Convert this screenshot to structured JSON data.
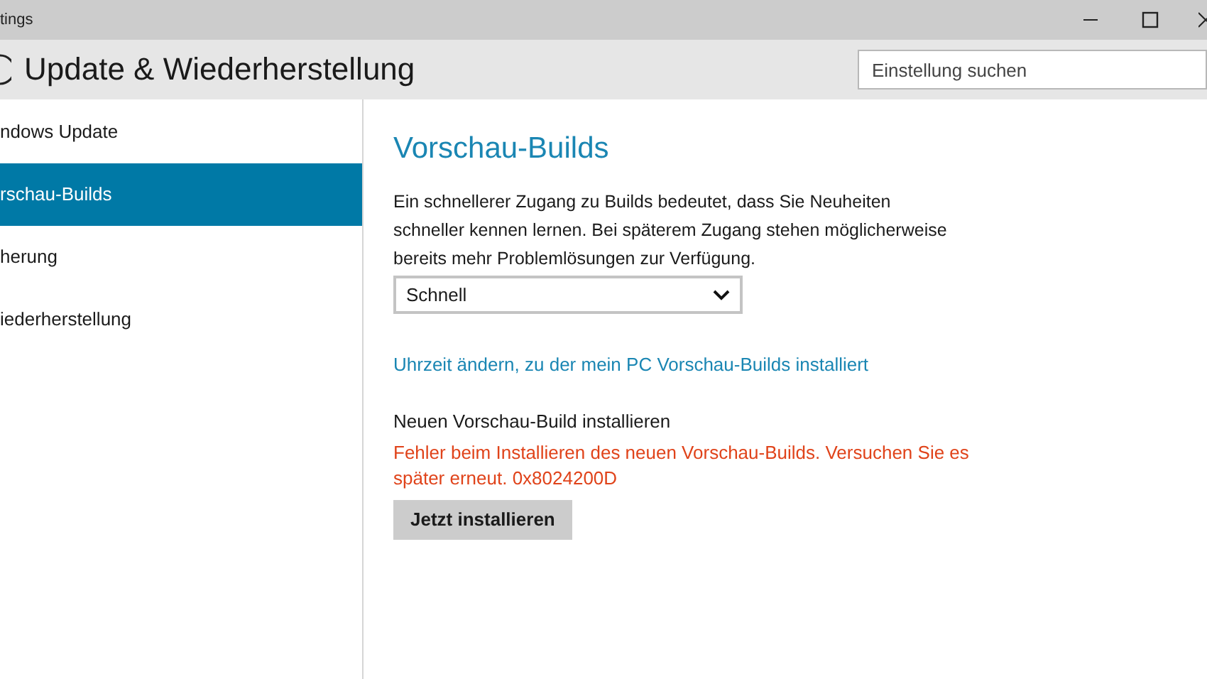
{
  "window": {
    "title": "tings"
  },
  "header": {
    "title": "Update & Wiederherstellung",
    "search": {
      "placeholder": "Einstellung suchen"
    }
  },
  "sidebar": {
    "items": [
      {
        "label": "ndows Update",
        "selected": false
      },
      {
        "label": "rschau-Builds",
        "selected": true
      },
      {
        "label": "herung",
        "selected": false
      },
      {
        "label": "iederherstellung",
        "selected": false
      }
    ]
  },
  "content": {
    "heading": "Vorschau-Builds",
    "description": "Ein schnellerer Zugang zu Builds bedeutet, dass Sie Neuheiten schneller kennen lernen. Bei späterem Zugang stehen möglicherweise bereits mehr Problemlösungen zur Verfügung.",
    "dropdown": {
      "value": "Schnell"
    },
    "link": "Uhrzeit ändern, zu der mein PC Vorschau-Builds installiert",
    "install_label": "Neuen Vorschau-Build installieren",
    "error": "Fehler beim Installieren des neuen Vorschau-Builds. Versuchen Sie es später erneut. 0x8024200D",
    "button": "Jetzt installieren"
  }
}
